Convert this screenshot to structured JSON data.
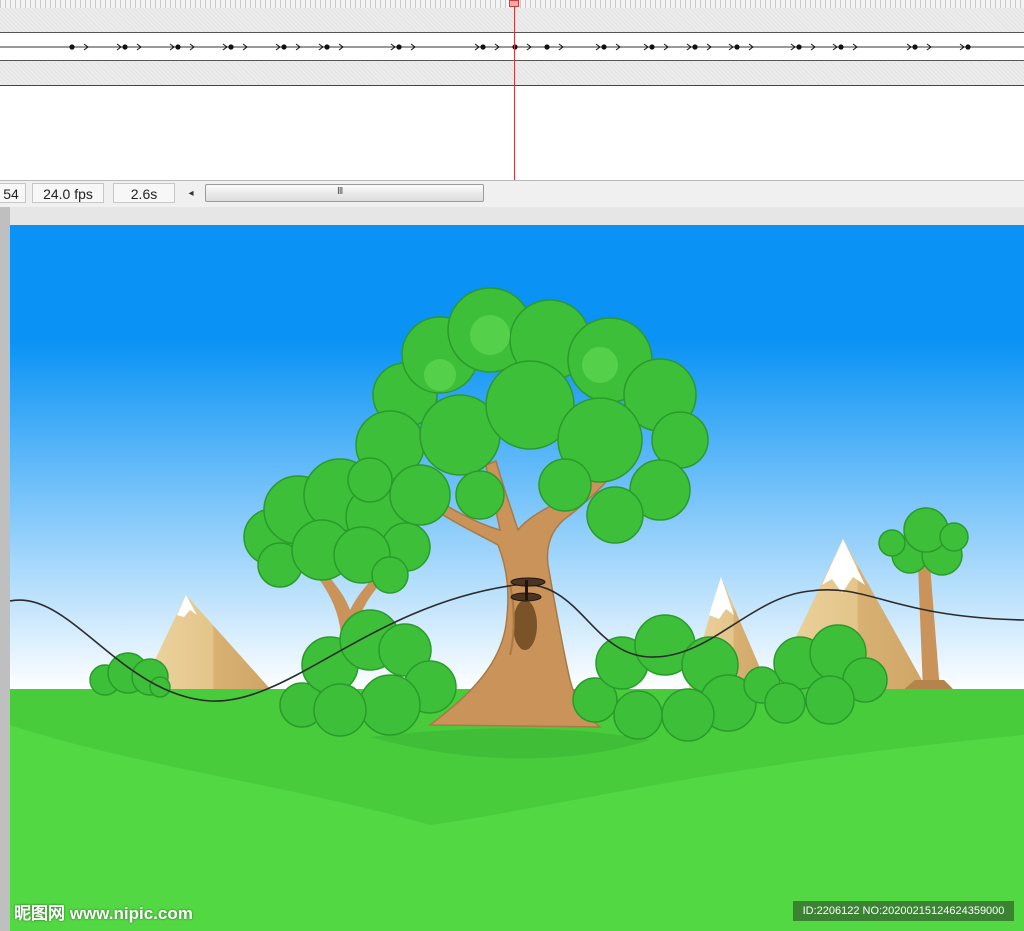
{
  "timeline": {
    "frame_number": "54",
    "fps": "24.0 fps",
    "elapsed_time": "2.6s",
    "scroll_left_glyph": "◂",
    "scroll_grip_glyph": "III",
    "playhead_color": "#d23a3a"
  },
  "stage": {
    "sky_top_color": "#0a93f5",
    "sky_bottom_color": "#ffffff",
    "grass_color": "#52d842",
    "foliage_color": "#3dbf3a",
    "trunk_color": "#c9935a"
  },
  "watermark": {
    "logo_text": "昵图网 www.nipic.com",
    "id_text": "ID:2206122 NO:20200215124624359000"
  }
}
